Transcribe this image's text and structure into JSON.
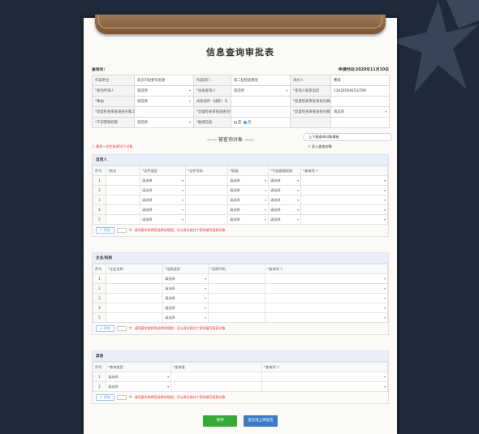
{
  "form": {
    "title": "信息查询审批表",
    "query_no_label": "查询号:",
    "apply_time_label": "申请时间:",
    "apply_time": "2020年11月10日"
  },
  "info": {
    "rows": [
      [
        [
          "作案单位",
          "lbl"
        ],
        [
          "北京市纪委市监委",
          "val"
        ],
        [
          "作案部门",
          "lbl"
        ],
        [
          "第二纪检监察室",
          "val"
        ],
        [
          "承办人",
          "lbl"
        ],
        [
          "曹琛",
          "val"
        ]
      ],
      [
        [
          "*查询申请人",
          "lbl"
        ],
        [
          "请选择",
          "sel"
        ],
        [
          "*协助查询人",
          "lbl"
        ],
        [
          "请选择",
          "sel"
        ],
        [
          "*查询人联系电话",
          "lbl"
        ],
        [
          "13026564653/789",
          "val"
        ]
      ],
      [
        [
          "*事由",
          "lbl"
        ],
        [
          "请选择",
          "sel"
        ],
        [
          "关联案件（线索）号",
          "lbl"
        ],
        [
          "",
          "val"
        ],
        [
          "*监督检查审查调查对象姓名",
          "lbl"
        ],
        [
          "",
          "val"
        ]
      ],
      [
        [
          "*监督检查审查调查对象工作单位",
          "lbl"
        ],
        [
          "",
          "val"
        ],
        [
          "*监督检查审查调查对象职务",
          "lbl"
        ],
        [
          "",
          "val"
        ],
        [
          "*监督检查审查调查对象级别",
          "lbl"
        ],
        [
          "请选择",
          "sel"
        ]
      ],
      [
        [
          "*干部管理权限",
          "lbl"
        ],
        [
          "请选择",
          "sel"
        ],
        [
          "*敏感信息",
          "lbl"
        ],
        [
          "radio",
          "radio"
        ],
        [
          "",
          "lbl"
        ],
        [
          "",
          "val"
        ]
      ]
    ],
    "radio_yes": "是",
    "radio_no": "否"
  },
  "target": {
    "title": "—— 被查询对象 ——",
    "download_btn": "上下载查询对象模板",
    "import_btn": "导入查询对象",
    "warning": "最多一次性查询50个对象"
  },
  "persons": {
    "title": "自然人",
    "columns": [
      "序号",
      "*姓名",
      "*证件类型",
      "*证件号码",
      "*职级",
      "*干部管理权限",
      "*查询项"
    ],
    "select_placeholder": "请选择",
    "rows": [
      "1",
      "2",
      "3",
      "4",
      "5"
    ],
    "add_label": "+ 添加",
    "count_unit": "个",
    "hint": "请同意学校将您选择的规程，可以再次前往个案的填写报表对象"
  },
  "orgs": {
    "title": "企业/机构",
    "columns": [
      "序号",
      "*企业名称",
      "*证照类型",
      "*证照代码",
      "*查询项"
    ],
    "select_placeholder": "请选择",
    "rows": [
      "1",
      "2",
      "3",
      "4",
      "5"
    ],
    "add_label": "+ 添加",
    "count_unit": "个",
    "hint": "请同意学校将您选择的规程，可以再次前往个案的填写报表对象"
  },
  "others": {
    "title": "其他",
    "columns": [
      "序号",
      "*查询类型",
      "*查询值",
      "*查询项"
    ],
    "select_placeholder": "请选择",
    "rows": [
      "1",
      "2"
    ],
    "add_label": "+ 添加",
    "count_unit": "个",
    "hint": "请同意学校将您选择的规程，可以再次前往个案的填写报表对象"
  },
  "footer": {
    "save": "保存",
    "submit": "提交线上审批流"
  }
}
